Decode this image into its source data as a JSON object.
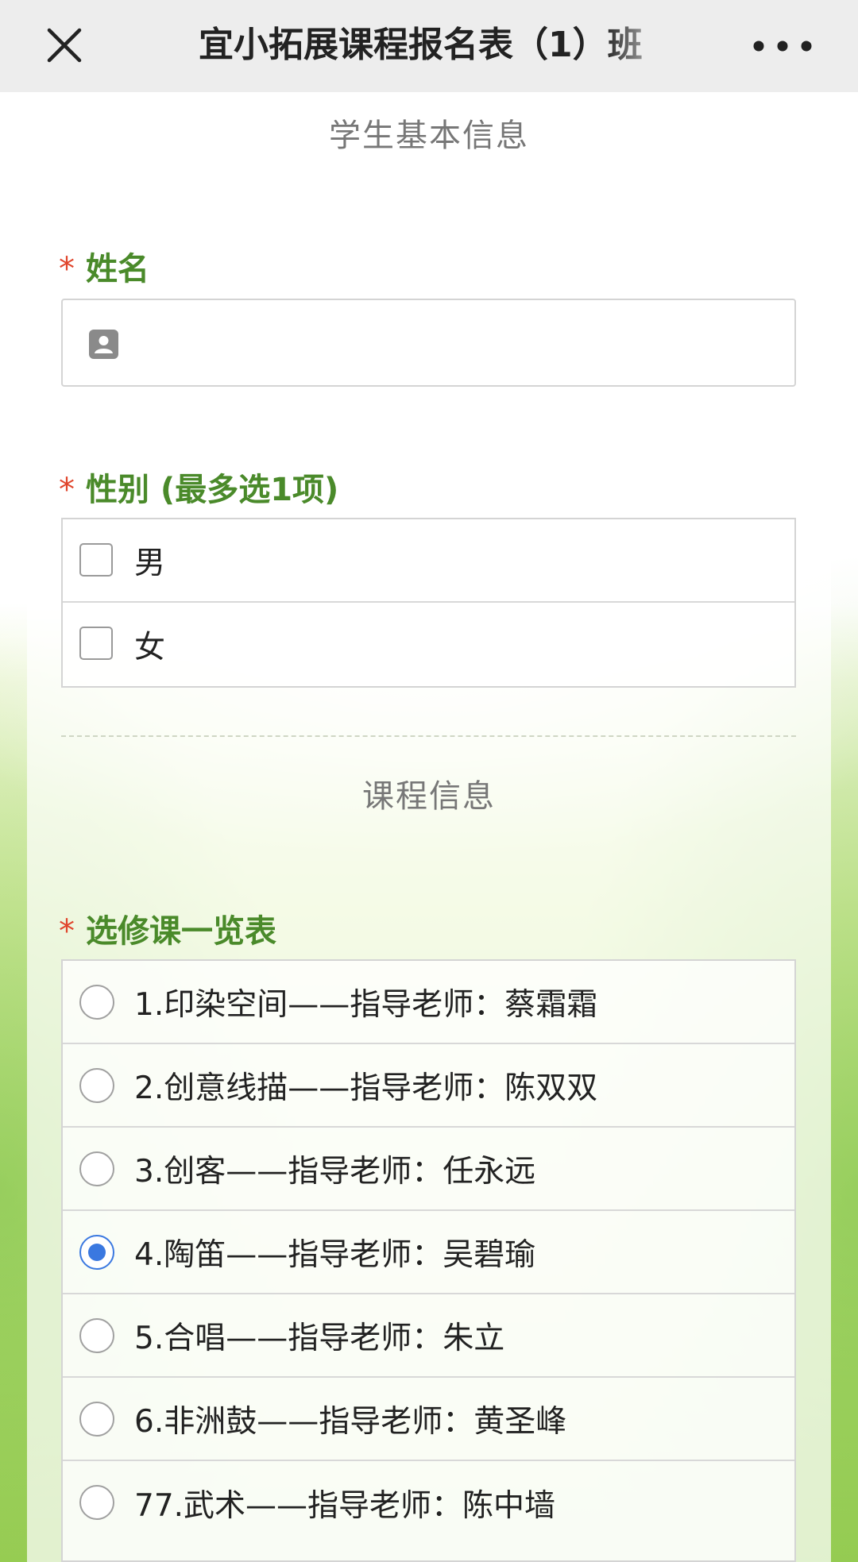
{
  "nav": {
    "title": "宜小拓展课程报名表（1）班",
    "close_icon": "close-icon",
    "more_icon": "more-dots-icon"
  },
  "sections": {
    "student_info": "学生基本信息",
    "course_info": "课程信息"
  },
  "name_field": {
    "required_mark": "*",
    "label": "姓名",
    "value": "",
    "icon": "person-card-icon"
  },
  "gender": {
    "required_mark": "*",
    "label": "性别 (最多选1项)",
    "options": [
      {
        "label": "男",
        "checked": false
      },
      {
        "label": "女",
        "checked": false
      }
    ]
  },
  "courses": {
    "required_mark": "*",
    "label": "选修课一览表",
    "options": [
      {
        "label": "1.印染空间——指导老师：蔡霜霜",
        "selected": false
      },
      {
        "label": "2.创意线描——指导老师：陈双双",
        "selected": false
      },
      {
        "label": "3.创客——指导老师：任永远",
        "selected": false
      },
      {
        "label": "4.陶笛——指导老师：吴碧瑜",
        "selected": true
      },
      {
        "label": "5.合唱——指导老师：朱立",
        "selected": false
      },
      {
        "label": "6.非洲鼓——指导老师：黄圣峰",
        "selected": false
      },
      {
        "label": "77.武术——指导老师：陈中墙",
        "selected": false
      }
    ]
  },
  "colors": {
    "label_green": "#4a8a2a",
    "required_red": "#e0452c",
    "radio_blue": "#3a78e0"
  }
}
